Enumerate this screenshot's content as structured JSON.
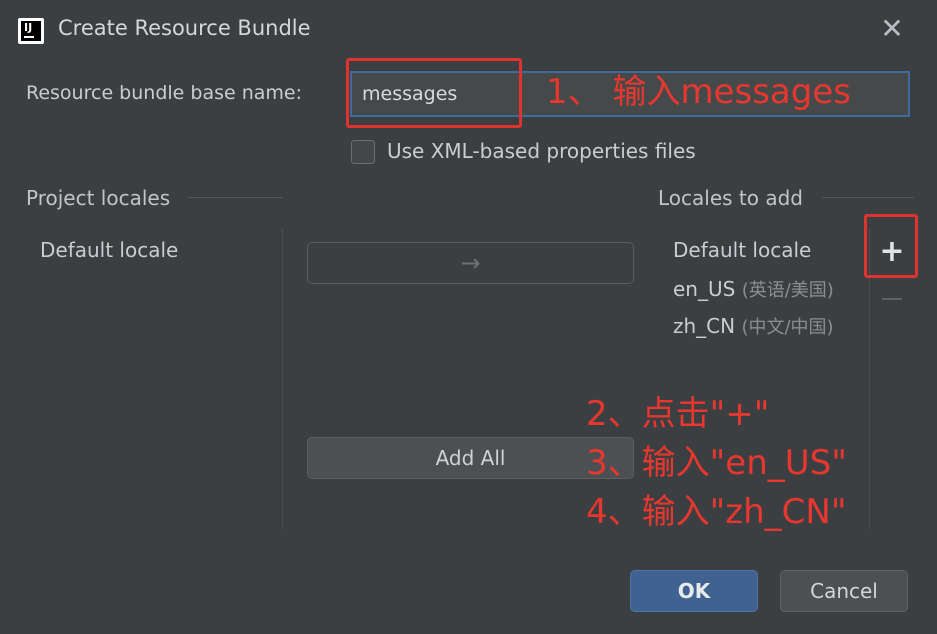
{
  "title": "Create Resource Bundle",
  "base_name": {
    "label": "Resource bundle base name:",
    "value": "messages"
  },
  "xml_checkbox": {
    "label": "Use XML-based properties files",
    "checked": false
  },
  "project_locales": {
    "title": "Project locales",
    "items": [
      "Default locale"
    ]
  },
  "locales_to_add": {
    "title": "Locales to add",
    "items": [
      {
        "code": "Default locale",
        "hint": ""
      },
      {
        "code": "en_US",
        "hint": "(英语/美国)"
      },
      {
        "code": "zh_CN",
        "hint": "(中文/中国)"
      }
    ]
  },
  "buttons": {
    "move": "→",
    "add_all": "Add All",
    "add": "+",
    "ok": "OK",
    "cancel": "Cancel",
    "close": "✕"
  },
  "annotations": {
    "step1": "1、 输入messages",
    "step2": "2、点击\"+\"",
    "step3": "3、输入\"en_US\"",
    "step4": "4、输入\"zh_CN\""
  },
  "colors": {
    "annotation": "#e8372f",
    "ok_button": "#3f6290"
  }
}
